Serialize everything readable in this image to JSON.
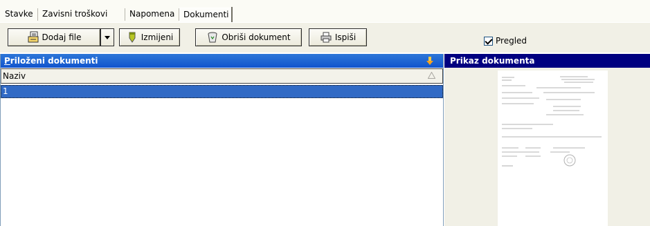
{
  "tabs": [
    {
      "label": "Stavke"
    },
    {
      "label": "Zavisni troškovi"
    },
    {
      "label": "Napomena"
    },
    {
      "label": "Dokumenti"
    }
  ],
  "toolbar": {
    "add_file_label": "Dodaj file",
    "edit_label": "Izmijeni",
    "delete_label": "Obriši dokument",
    "print_label": "Ispiši",
    "preview_checkbox_label": "Pregled",
    "preview_checked": true
  },
  "attachments_panel": {
    "title_prefix": "P",
    "title_rest": "riloženi dokumenti",
    "column_header": "Naziv",
    "rows": [
      {
        "naziv": "1",
        "selected": true
      }
    ]
  },
  "preview_panel": {
    "title": "Prikaz dokumenta"
  },
  "colors": {
    "selection": "#316ac5",
    "header_blue": "#1a5fd0",
    "header_navy": "#000080",
    "toolbar_bg": "#f1f0e6"
  }
}
